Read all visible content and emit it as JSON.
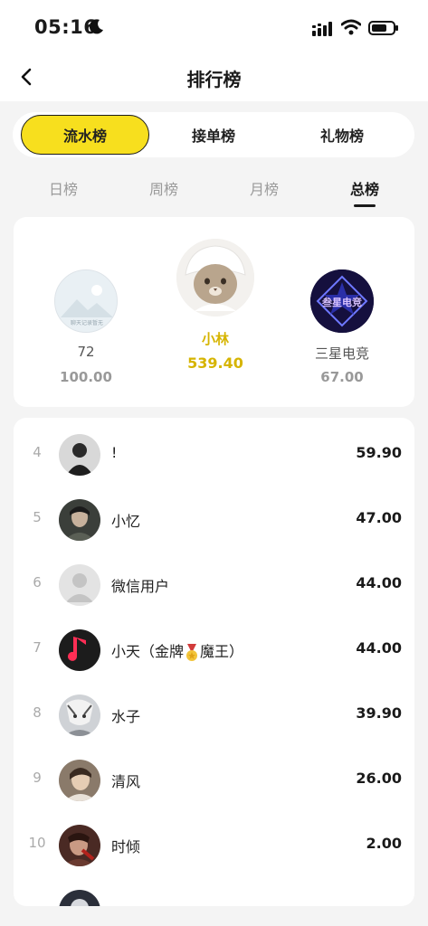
{
  "status_bar": {
    "time": "05:16"
  },
  "nav": {
    "title": "排行榜"
  },
  "main_tabs": [
    {
      "label": "流水榜",
      "active": true
    },
    {
      "label": "接单榜",
      "active": false
    },
    {
      "label": "礼物榜",
      "active": false
    }
  ],
  "period_tabs": [
    {
      "label": "日榜",
      "active": false
    },
    {
      "label": "周榜",
      "active": false
    },
    {
      "label": "月榜",
      "active": false
    },
    {
      "label": "总榜",
      "active": true
    }
  ],
  "podium": {
    "second": {
      "name": "72",
      "score": "100.00",
      "avatar_caption": "聊天记录暂无"
    },
    "first": {
      "name": "小林",
      "score": "539.40"
    },
    "third": {
      "name": "三星电竞",
      "score": "67.00",
      "avatar_caption": "叁星电竞"
    }
  },
  "ranking": [
    {
      "rank": "4",
      "name": "!",
      "score": "59.90"
    },
    {
      "rank": "5",
      "name": "小忆",
      "score": "47.00"
    },
    {
      "rank": "6",
      "name": "微信用户",
      "score": "44.00"
    },
    {
      "rank": "7",
      "name_prefix": "小天（金牌",
      "name_suffix": "魔王）",
      "score": "44.00"
    },
    {
      "rank": "8",
      "name": "水子",
      "score": "39.90"
    },
    {
      "rank": "9",
      "name": "清风",
      "score": "26.00"
    },
    {
      "rank": "10",
      "name": "时倾",
      "score": "2.00"
    }
  ],
  "colors": {
    "accent": "#f7df1e",
    "gold_text": "#d6b400"
  }
}
